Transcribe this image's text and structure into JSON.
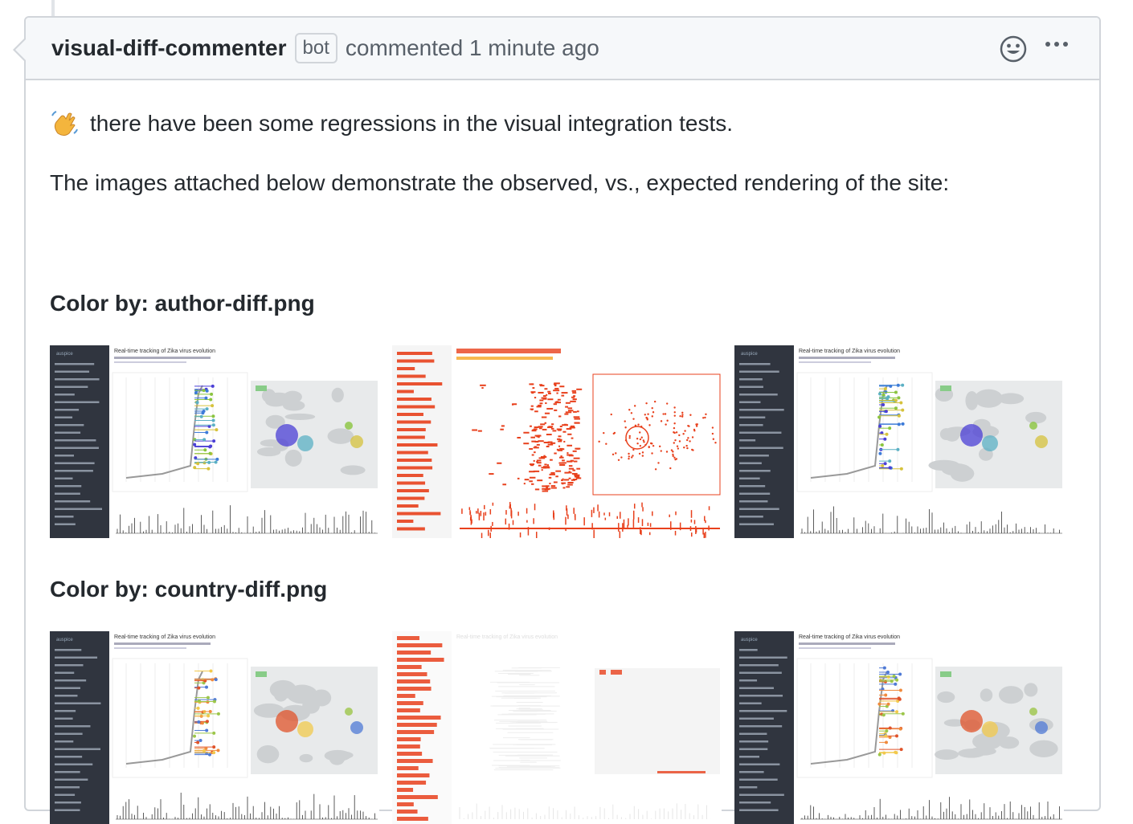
{
  "comment": {
    "author": "visual-diff-commenter",
    "badge": "bot",
    "meta": "commented 1 minute ago",
    "intro": "there have been some regressions in the visual integration tests.",
    "description": "The images attached below demonstrate the observed, vs., expected rendering of the site:",
    "sections": [
      {
        "heading": "Color by: author-diff.png"
      },
      {
        "heading": "Color by: country-diff.png"
      }
    ],
    "app_title": "Real-time tracking of Zika virus evolution",
    "app_brand": "auspice"
  },
  "icons": {
    "emoji": "smiley-icon",
    "more": "kebab-icon",
    "wave": "waving-hand-icon"
  },
  "colors": {
    "sidebar": "#30353f",
    "diff": "#e8401c",
    "header_bg": "#f6f8fa"
  }
}
